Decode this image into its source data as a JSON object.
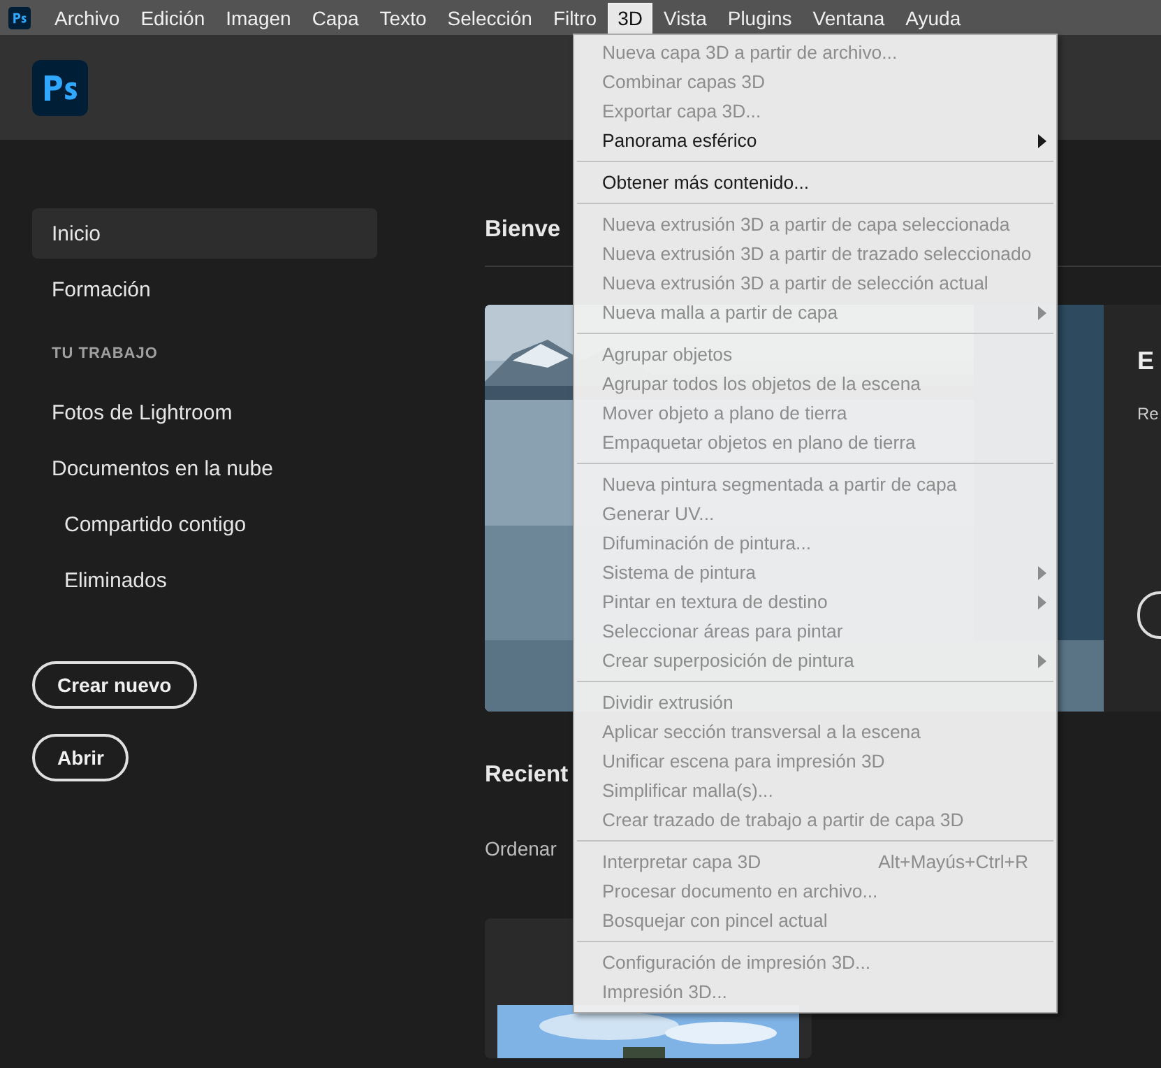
{
  "menu_bar": {
    "items": [
      {
        "label": "Archivo",
        "selected": false
      },
      {
        "label": "Edición",
        "selected": false
      },
      {
        "label": "Imagen",
        "selected": false
      },
      {
        "label": "Capa",
        "selected": false
      },
      {
        "label": "Texto",
        "selected": false
      },
      {
        "label": "Selección",
        "selected": false
      },
      {
        "label": "Filtro",
        "selected": false
      },
      {
        "label": "3D",
        "selected": true
      },
      {
        "label": "Vista",
        "selected": false
      },
      {
        "label": "Plugins",
        "selected": false
      },
      {
        "label": "Ventana",
        "selected": false
      },
      {
        "label": "Ayuda",
        "selected": false
      }
    ]
  },
  "sidebar": {
    "items": [
      {
        "kind": "item",
        "label": "Inicio",
        "selected": true
      },
      {
        "kind": "item",
        "label": "Formación",
        "selected": false
      },
      {
        "kind": "heading",
        "label": "TU TRABAJO"
      },
      {
        "kind": "item",
        "label": "Fotos de Lightroom",
        "selected": false
      },
      {
        "kind": "item",
        "label": "Documentos en la nube",
        "selected": false
      },
      {
        "kind": "subitem",
        "label": "Compartido contigo",
        "selected": false
      },
      {
        "kind": "subitem",
        "label": "Eliminados",
        "selected": false
      }
    ],
    "buttons": [
      "Crear nuevo",
      "Abrir"
    ]
  },
  "main": {
    "welcome_title": "Bienve",
    "hero": {
      "title": "E",
      "text": "Re"
    },
    "recent_title": "Recient",
    "sort_label": "Ordenar"
  },
  "menu": {
    "items": [
      {
        "kind": "item",
        "label": "Nueva capa 3D a partir de archivo...",
        "disabled": true,
        "submenu": false
      },
      {
        "kind": "item",
        "label": "Combinar capas 3D",
        "disabled": true,
        "submenu": false
      },
      {
        "kind": "item",
        "label": "Exportar capa 3D...",
        "disabled": true,
        "submenu": false
      },
      {
        "kind": "item",
        "label": "Panorama esférico",
        "disabled": false,
        "submenu": true
      },
      {
        "kind": "separator"
      },
      {
        "kind": "item",
        "label": "Obtener más contenido...",
        "disabled": false,
        "submenu": false
      },
      {
        "kind": "separator"
      },
      {
        "kind": "item",
        "label": "Nueva extrusión 3D a partir de capa seleccionada",
        "disabled": true,
        "submenu": false
      },
      {
        "kind": "item",
        "label": "Nueva extrusión 3D a partir de trazado seleccionado",
        "disabled": true,
        "submenu": false
      },
      {
        "kind": "item",
        "label": "Nueva extrusión 3D a partir de selección actual",
        "disabled": true,
        "submenu": false
      },
      {
        "kind": "item",
        "label": "Nueva malla a partir de capa",
        "disabled": true,
        "submenu": true
      },
      {
        "kind": "separator"
      },
      {
        "kind": "item",
        "label": "Agrupar objetos",
        "disabled": true,
        "submenu": false
      },
      {
        "kind": "item",
        "label": "Agrupar todos los objetos de la escena",
        "disabled": true,
        "submenu": false
      },
      {
        "kind": "item",
        "label": "Mover objeto a plano de tierra",
        "disabled": true,
        "submenu": false
      },
      {
        "kind": "item",
        "label": "Empaquetar objetos en plano de tierra",
        "disabled": true,
        "submenu": false
      },
      {
        "kind": "separator"
      },
      {
        "kind": "item",
        "label": "Nueva pintura segmentada a partir de capa",
        "disabled": true,
        "submenu": false
      },
      {
        "kind": "item",
        "label": "Generar UV...",
        "disabled": true,
        "submenu": false
      },
      {
        "kind": "item",
        "label": "Difuminación de pintura...",
        "disabled": true,
        "submenu": false
      },
      {
        "kind": "item",
        "label": "Sistema de pintura",
        "disabled": true,
        "submenu": true
      },
      {
        "kind": "item",
        "label": "Pintar en textura de destino",
        "disabled": true,
        "submenu": true
      },
      {
        "kind": "item",
        "label": "Seleccionar áreas para pintar",
        "disabled": true,
        "submenu": false
      },
      {
        "kind": "item",
        "label": "Crear superposición de pintura",
        "disabled": true,
        "submenu": true
      },
      {
        "kind": "separator"
      },
      {
        "kind": "item",
        "label": "Dividir extrusión",
        "disabled": true,
        "submenu": false
      },
      {
        "kind": "item",
        "label": "Aplicar sección transversal a la escena",
        "disabled": true,
        "submenu": false
      },
      {
        "kind": "item",
        "label": "Unificar escena para impresión 3D",
        "disabled": true,
        "submenu": false
      },
      {
        "kind": "item",
        "label": "Simplificar malla(s)...",
        "disabled": true,
        "submenu": false
      },
      {
        "kind": "item",
        "label": "Crear trazado de trabajo a partir de capa 3D",
        "disabled": true,
        "submenu": false
      },
      {
        "kind": "separator"
      },
      {
        "kind": "item",
        "label": "Interpretar capa 3D",
        "shortcut": "Alt+Mayús+Ctrl+R",
        "disabled": true,
        "submenu": false
      },
      {
        "kind": "item",
        "label": "Procesar documento en archivo...",
        "disabled": true,
        "submenu": false
      },
      {
        "kind": "item",
        "label": "Bosquejar con pincel actual",
        "disabled": true,
        "submenu": false
      },
      {
        "kind": "separator"
      },
      {
        "kind": "item",
        "label": "Configuración de impresión 3D...",
        "disabled": true,
        "submenu": false
      },
      {
        "kind": "item",
        "label": "Impresión 3D...",
        "disabled": true,
        "submenu": false
      }
    ]
  }
}
